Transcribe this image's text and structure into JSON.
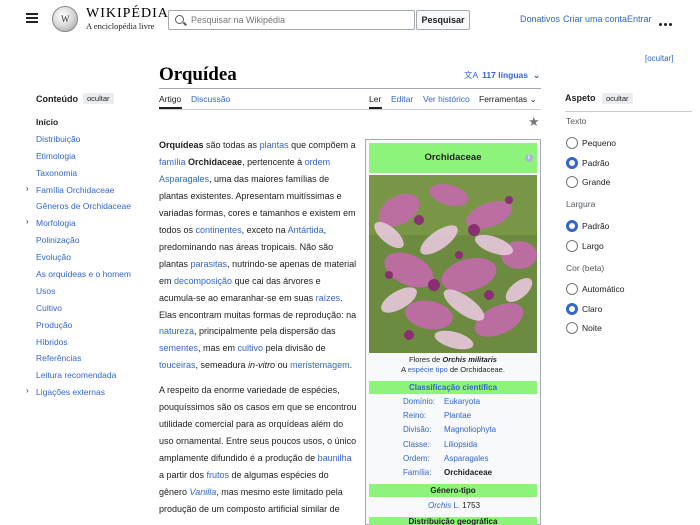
{
  "header": {
    "wordmark": "WIKIPÉDIA",
    "tagline": "A enciclopédia livre",
    "search_placeholder": "Pesquisar na Wikipédia",
    "search_button": "Pesquisar",
    "links": [
      "Donativos",
      "Criar uma conta",
      "Entrar"
    ]
  },
  "ocultar_top": "[ocultar]",
  "toc": {
    "title": "Conteúdo",
    "hide": "ocultar",
    "items": [
      {
        "label": "Início",
        "active": true,
        "expandable": false
      },
      {
        "label": "Distribuição",
        "expandable": false
      },
      {
        "label": "Etimologia",
        "expandable": false
      },
      {
        "label": "Taxonomia",
        "expandable": false
      },
      {
        "label": "Família Orchidaceae",
        "expandable": true
      },
      {
        "label": "Gêneros de Orchidaceae",
        "expandable": false
      },
      {
        "label": "Morfologia",
        "expandable": true
      },
      {
        "label": "Polinização",
        "expandable": false
      },
      {
        "label": "Evolução",
        "expandable": false
      },
      {
        "label": "As orquídeas e o homem",
        "expandable": false
      },
      {
        "label": "Usos",
        "expandable": false
      },
      {
        "label": "Cultivo",
        "expandable": false
      },
      {
        "label": "Produção",
        "expandable": false
      },
      {
        "label": "Híbridos",
        "expandable": false
      },
      {
        "label": "Referências",
        "expandable": false
      },
      {
        "label": "Leitura recomendada",
        "expandable": false
      },
      {
        "label": "Ligações externas",
        "expandable": true
      }
    ]
  },
  "article": {
    "title": "Orquídea",
    "languages": "117 línguas",
    "tabs_left": [
      "Artigo",
      "Discussão"
    ],
    "tabs_right": [
      "Ler",
      "Editar",
      "Ver histórico",
      "Ferramentas"
    ]
  },
  "body": {
    "p1": [
      {
        "t": "Orquídeas",
        "s": "b"
      },
      {
        "t": " são todas as "
      },
      {
        "t": "plantas",
        "s": "a"
      },
      {
        "t": " que compõem a "
      },
      {
        "t": "família",
        "s": "a"
      },
      {
        "t": " "
      },
      {
        "t": "Orchidaceae",
        "s": "b"
      },
      {
        "t": ", pertencente à "
      },
      {
        "t": "ordem",
        "s": "a"
      },
      {
        "t": " "
      },
      {
        "t": "Asparagales",
        "s": "a"
      },
      {
        "t": ", uma das maiores famílias de plantas existentes. Apresentam muitíssimas e variadas formas, cores e tamanhos e existem em todos os "
      },
      {
        "t": "continentes",
        "s": "a"
      },
      {
        "t": ", exceto na "
      },
      {
        "t": "Antártida",
        "s": "a"
      },
      {
        "t": ", predominando nas áreas tropicais. Não são plantas "
      },
      {
        "t": "parasitas",
        "s": "a"
      },
      {
        "t": ", nutrindo-se apenas de material em "
      },
      {
        "t": "decomposição",
        "s": "a"
      },
      {
        "t": " que cai das árvores e acumula-se ao emaranhar-se em suas "
      },
      {
        "t": "raízes",
        "s": "a"
      },
      {
        "t": ". Elas encontram muitas formas de reprodução: na "
      },
      {
        "t": "natureza",
        "s": "a"
      },
      {
        "t": ", principalmente pela dispersão das "
      },
      {
        "t": "sementes",
        "s": "a"
      },
      {
        "t": ", mas em "
      },
      {
        "t": "cultivo",
        "s": "a"
      },
      {
        "t": " pela divisão de "
      },
      {
        "t": "touceiras",
        "s": "a"
      },
      {
        "t": ", semeadura "
      },
      {
        "t": "in-vitro",
        "s": "i"
      },
      {
        "t": " ou "
      },
      {
        "t": "meristemagem",
        "s": "a"
      },
      {
        "t": "."
      }
    ],
    "p2": [
      {
        "t": "A respeito da enorme variedade de espécies, pouquíssimos são os casos em que se encontrou utilidade comercial para as orquídeas além do uso ornamental. Entre seus poucos usos, o único amplamente difundido é a produção de "
      },
      {
        "t": "baunilha",
        "s": "a"
      },
      {
        "t": " a partir dos "
      },
      {
        "t": "frutos",
        "s": "a"
      },
      {
        "t": " de algumas espécies do gênero "
      },
      {
        "t": "Vanilla",
        "s": "ai"
      },
      {
        "t": ", mas mesmo este limitado pela produção de um composto artificial similar de"
      }
    ]
  },
  "infobox": {
    "title": "Orchidaceae",
    "caption_pre": "Flores de ",
    "caption_species": "Orchis militaris",
    "caption_a": "A ",
    "caption_link": "espécie tipo",
    "caption_post": " de Orchidaceae.",
    "band_class": "Classificação científica",
    "taxonomy": [
      {
        "k": "Domínio:",
        "v": "Eukaryota",
        "link": true
      },
      {
        "k": "Reino:",
        "v": "Plantae",
        "link": true
      },
      {
        "k": "Divisão:",
        "v": "Magnoliophyta",
        "link": true
      },
      {
        "k": "Classe:",
        "v": "Liliopsida",
        "link": true
      },
      {
        "k": "Ordem:",
        "v": "Asparagales",
        "link": true
      },
      {
        "k": "Família:",
        "v": "Orchidaceae",
        "link": false
      }
    ],
    "band_genus": "Género-tipo",
    "genus": "Orchis",
    "genus_author": "L.",
    "genus_year": "1753",
    "band_distribution": "Distribuição geográfica"
  },
  "appearance": {
    "title": "Aspeto",
    "hide": "ocultar",
    "text_label": "Texto",
    "text_options": [
      {
        "label": "Pequeno",
        "on": false
      },
      {
        "label": "Padrão",
        "on": true
      },
      {
        "label": "Grande",
        "on": false
      }
    ],
    "width_label": "Largura",
    "width_options": [
      {
        "label": "Padrão",
        "on": true
      },
      {
        "label": "Largo",
        "on": false
      }
    ],
    "color_label": "Cor (beta)",
    "color_options": [
      {
        "label": "Automático",
        "on": false
      },
      {
        "label": "Claro",
        "on": true
      },
      {
        "label": "Noite",
        "on": false
      }
    ]
  }
}
